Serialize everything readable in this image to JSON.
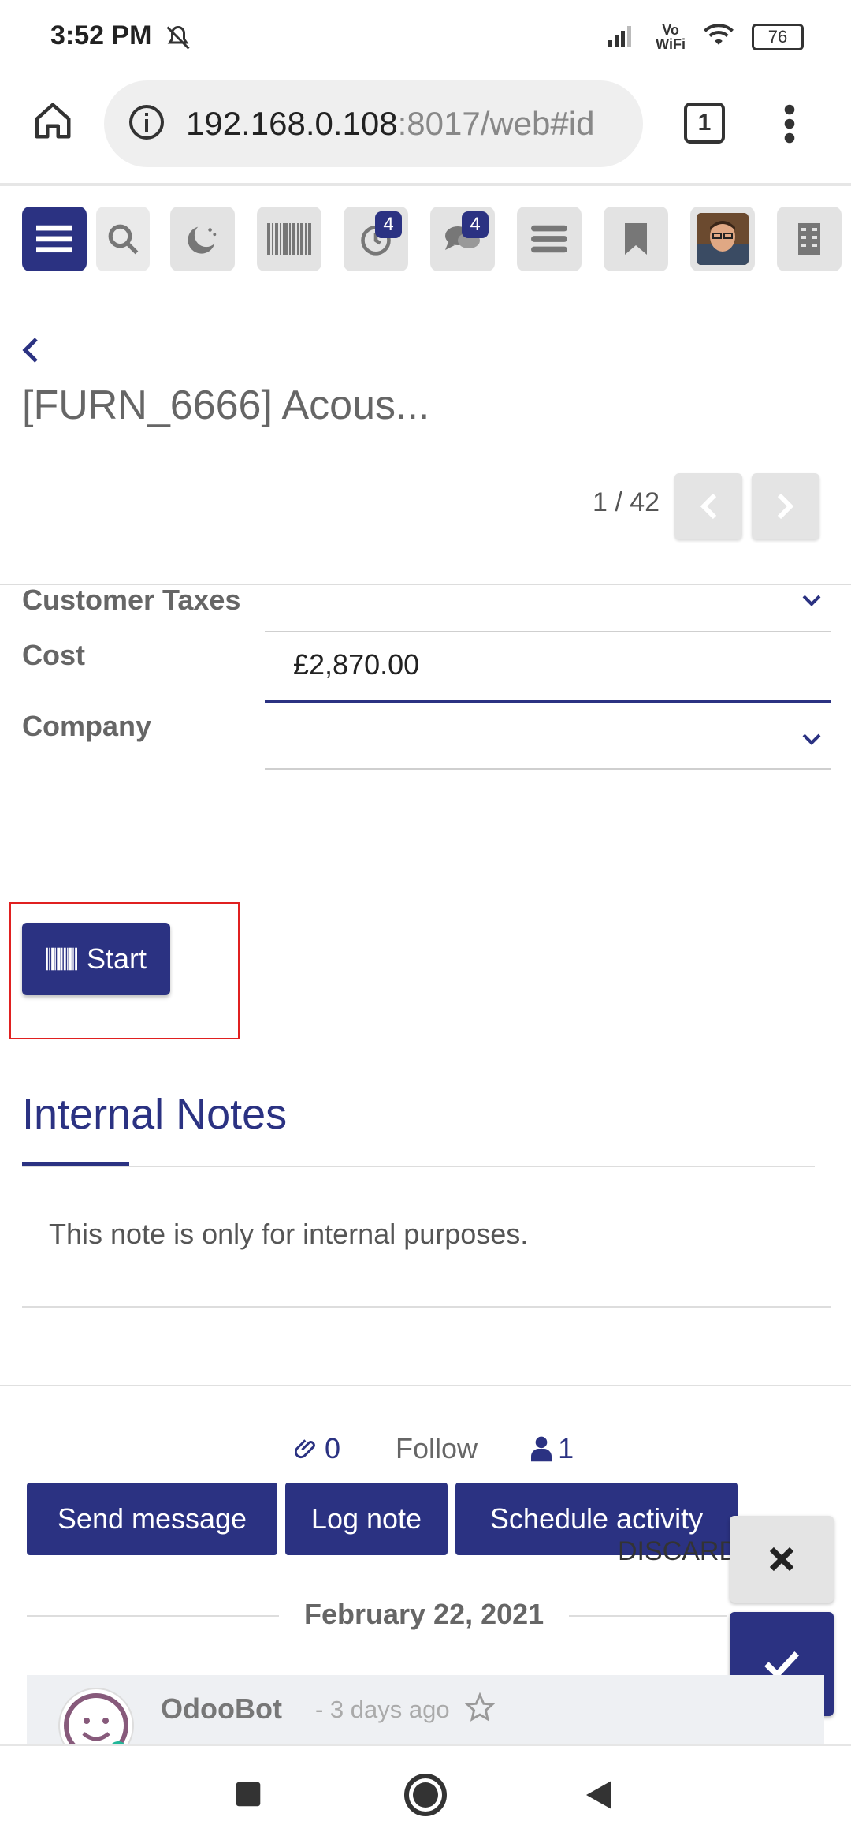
{
  "status_bar": {
    "time": "3:52 PM",
    "battery": "76",
    "vowifi_top": "Vo",
    "vowifi_bottom": "WiFi"
  },
  "browser": {
    "url_host": "192.168.0.108",
    "url_rest": ":8017/web#id",
    "tab_count": "1"
  },
  "toolbar": {
    "activity_badge": "4",
    "messages_badge": "4"
  },
  "record": {
    "title": "[FURN_6666] Acous...",
    "pager": "1 / 42"
  },
  "fields": {
    "customer_taxes_label": "Customer Taxes",
    "cost_label": "Cost",
    "cost_value": "£2,870.00",
    "company_label": "Company"
  },
  "start_button": {
    "label": "Start"
  },
  "notes": {
    "heading": "Internal Notes",
    "text": "This note is only for internal purposes."
  },
  "chatter": {
    "attachments": "0",
    "follow": "Follow",
    "followers": "1",
    "send_message": "Send message",
    "log_note": "Log note",
    "schedule_activity": "Schedule activity",
    "discard": "DISCARD",
    "date": "February 22, 2021",
    "author": "OdooBot",
    "time_ago": "- 3 days ago"
  },
  "colors": {
    "brand": "#2b3282",
    "highlight": "#e02020"
  }
}
